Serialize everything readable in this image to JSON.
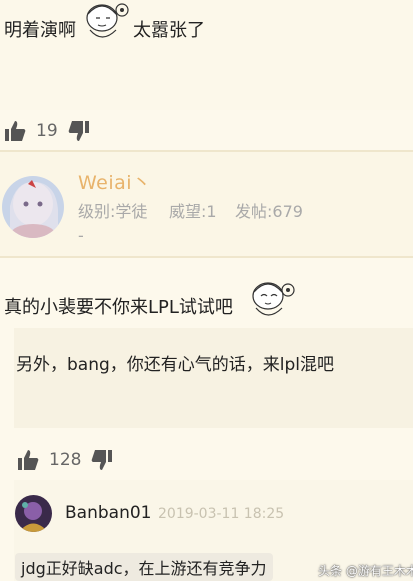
{
  "post1": {
    "text_left": "明着演啊",
    "text_right": "太嚣张了"
  },
  "post1_votes": {
    "up_count": "19"
  },
  "user": {
    "name": "Weiai丶",
    "level": "级别:学徒",
    "prestige": "威望:1",
    "posts": "发帖:679",
    "dash": "-"
  },
  "post2": {
    "text": "真的小裴要不你来LPL试试吧"
  },
  "reply": {
    "text": "另外，bang，你还有心气的话，来lpl混吧"
  },
  "post2_votes": {
    "up_count": "128"
  },
  "comment": {
    "author": "Banban01",
    "time": "2019-03-11 18:25",
    "text": "jdg正好缺adc，在上游还有竞争力"
  },
  "watermark": "头条 @游有王木木"
}
